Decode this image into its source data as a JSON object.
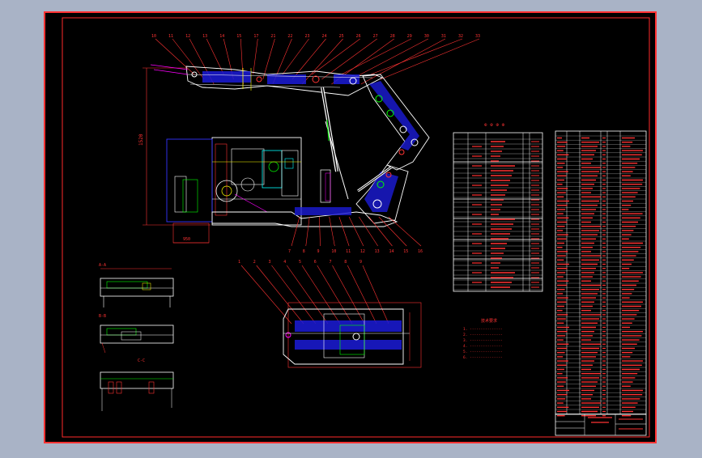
{
  "colors": {
    "viewport_bg": "#a9b3c6",
    "sheet_bg": "#000000",
    "sheet_frame": "#ff0000",
    "outline": "#ffffff",
    "dimension": "#ff0000",
    "hydraulic": "#3333ff",
    "hidden": "#00ffff",
    "green_parts": "#00ff00",
    "yellow_parts": "#ffff00",
    "magenta_parts": "#ff00ff"
  },
  "callouts_top": [
    "10",
    "11",
    "12",
    "13",
    "14",
    "15",
    "17",
    "21",
    "22",
    "23",
    "24",
    "25",
    "26",
    "27",
    "28",
    "29",
    "30",
    "31",
    "32",
    "33"
  ],
  "callouts_bottom": [
    "7",
    "8",
    "9",
    "10",
    "11",
    "12",
    "13",
    "14",
    "15",
    "16"
  ],
  "plan_view_callouts": [
    "1",
    "2",
    "3",
    "4",
    "5",
    "6",
    "7",
    "8",
    "9"
  ],
  "dims": {
    "height": "1520",
    "width_label": "950"
  },
  "left_detail_labels": [
    "A-A",
    "B-B",
    "C-C"
  ],
  "main_table_title": "⊕ ⊕ ⊕ ⊕",
  "notes_title": "技术要求",
  "notes_lines": [
    "1. ---------------",
    "2. ---------------",
    "3. ---------------",
    "4. ---------------",
    "5. ---------------",
    "6. ---------------"
  ]
}
